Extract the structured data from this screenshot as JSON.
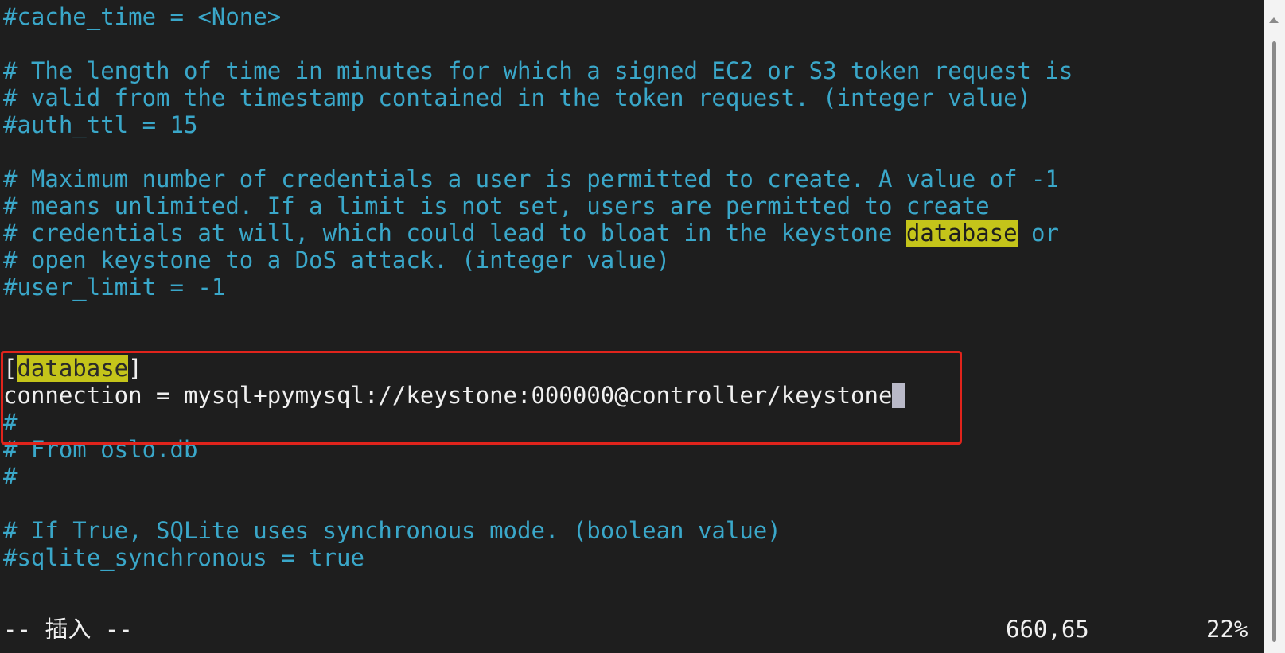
{
  "editor": {
    "lines": [
      "#cache_time = <None>",
      "",
      "# The length of time in minutes for which a signed EC2 or S3 token request is",
      "# valid from the timestamp contained in the token request. (integer value)",
      "#auth_ttl = 15",
      "",
      "# Maximum number of credentials a user is permitted to create. A value of -1",
      "# means unlimited. If a limit is not set, users are permitted to create",
      "# credentials at will, which could lead to bloat in the keystone ",
      "database",
      " or",
      "# open keystone to a DoS attack. (integer value)",
      "#user_limit = -1",
      "",
      "",
      "[",
      "database",
      "]",
      "connection = mysql+pymysql://keystone:000000@controller/keystone",
      "#",
      "# From oslo.db",
      "#",
      "",
      "# If True, SQLite uses synchronous mode. (boolean value)",
      "#sqlite_synchronous = true"
    ],
    "search_term": "database"
  },
  "status_bar": {
    "mode": "-- 插入 --",
    "position": "660,65",
    "percent": "22%"
  },
  "colors": {
    "background": "#1e1e1e",
    "comment": "#3aa7c9",
    "text": "#f0f0f0",
    "search_highlight": "#c4c41a",
    "annotation_box": "#e0241c"
  }
}
